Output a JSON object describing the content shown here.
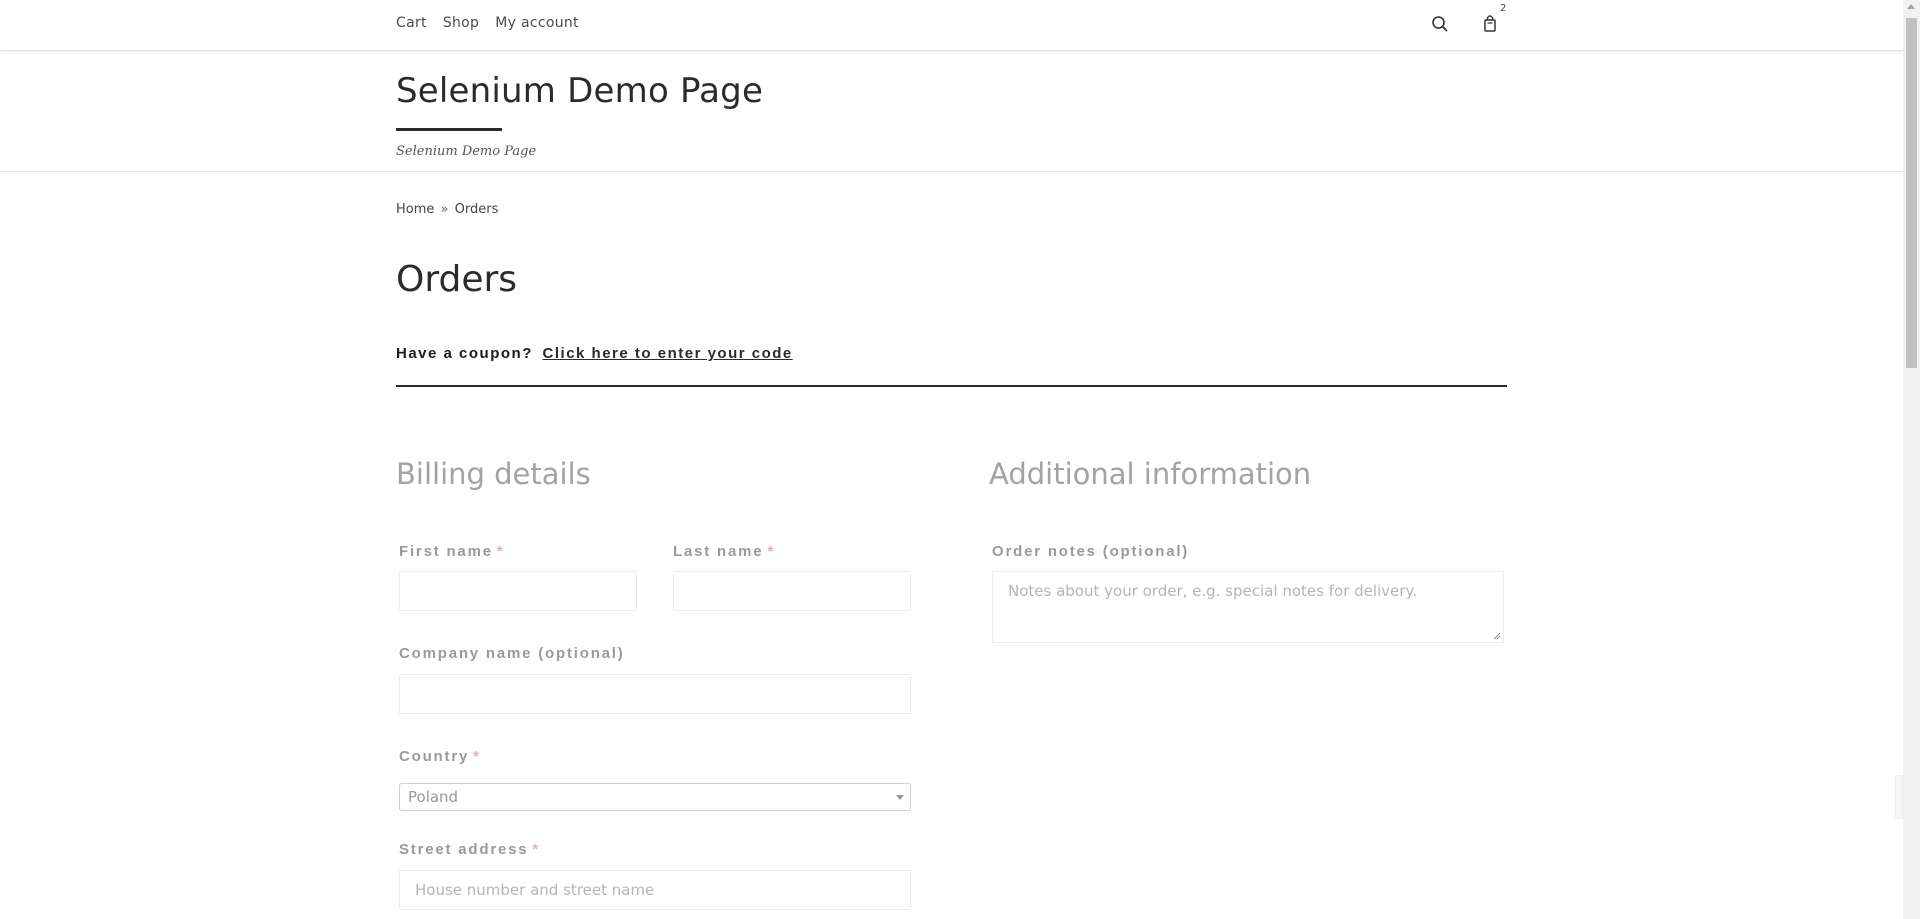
{
  "topnav": {
    "items": [
      {
        "label": "Cart"
      },
      {
        "label": "Shop"
      },
      {
        "label": "My account"
      }
    ],
    "cart_count": "2",
    "search_icon": "search-icon",
    "cart_icon": "shopping-bag-icon"
  },
  "header": {
    "site_title": "Selenium Demo Page",
    "tagline": "Selenium Demo Page"
  },
  "breadcrumb": {
    "home": "Home",
    "separator": "»",
    "current": "Orders"
  },
  "page": {
    "title": "Orders"
  },
  "coupon": {
    "prompt": "Have a coupon?",
    "link": "Click here to enter your code"
  },
  "billing": {
    "heading": "Billing details",
    "first_name_label": "First name",
    "last_name_label": "Last name",
    "company_label": "Company name (optional)",
    "country_label": "Country",
    "country_value": "Poland",
    "street_label": "Street address",
    "street_placeholder": "House number and street name",
    "required_mark": "*"
  },
  "additional": {
    "heading": "Additional information",
    "notes_label": "Order notes (optional)",
    "notes_placeholder": "Notes about your order, e.g. special notes for delivery."
  },
  "colors": {
    "accent": "#2b2b2b",
    "muted_heading": "#a3a3a3",
    "required": "#f2a9a9"
  }
}
